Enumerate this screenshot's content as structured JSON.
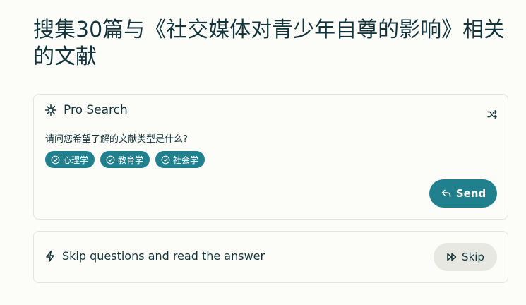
{
  "page": {
    "title": "搜集30篇与《社交媒体对青少年自尊的影响》相关的文献"
  },
  "pro_search": {
    "label": "Pro Search",
    "icon": "sparkle-icon",
    "shuffle_icon": "shuffle-icon",
    "question": "请问您希望了解的文献类型是什么?",
    "options": [
      "心理学",
      "教育学",
      "社会学"
    ],
    "send_label": "Send"
  },
  "skip": {
    "text": "Skip questions and read the answer",
    "button_label": "Skip",
    "icon": "lightning-icon"
  },
  "colors": {
    "accent": "#21808d",
    "text": "#13343b",
    "background": "#fcfcf9",
    "border": "#e3e3df",
    "skip_button_bg": "#e8e8e3"
  }
}
